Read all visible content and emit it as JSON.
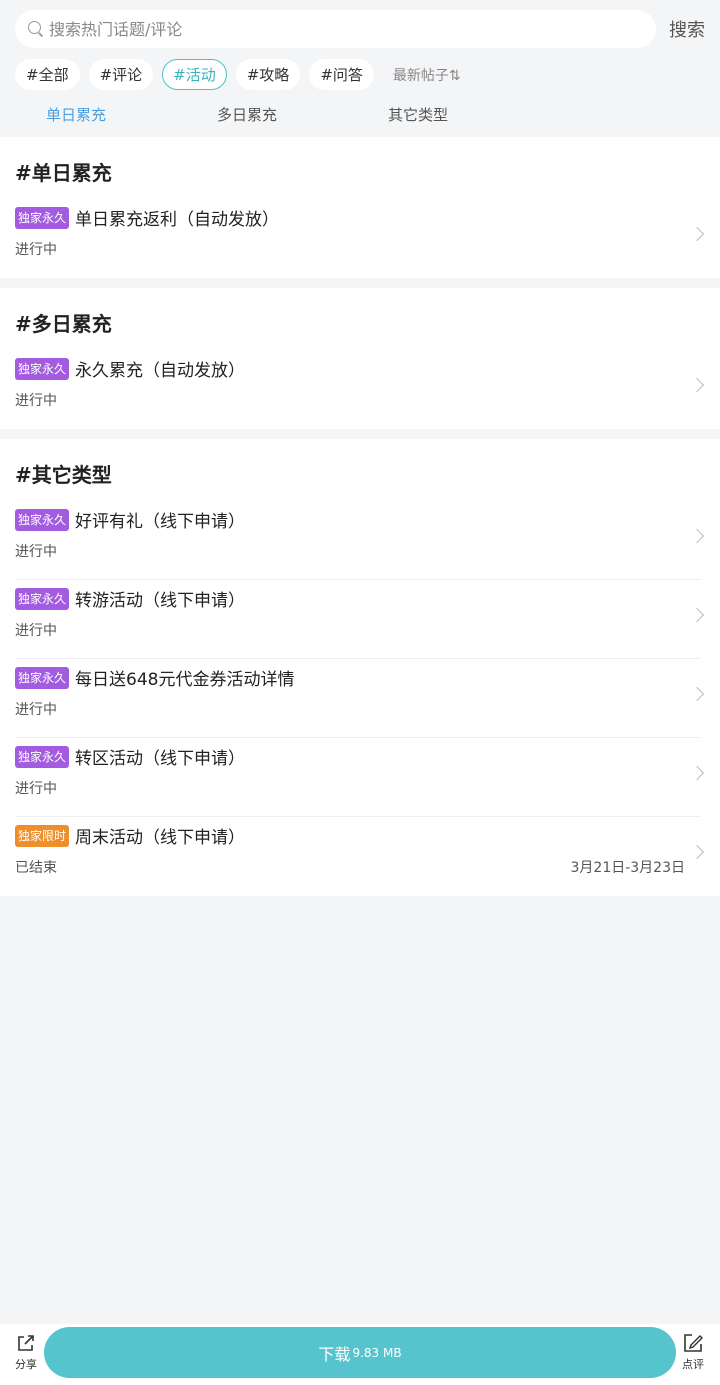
{
  "search": {
    "placeholder": "搜索热门话题/评论",
    "button_label": "搜索"
  },
  "chips": [
    {
      "label": "#全部",
      "active": false
    },
    {
      "label": "#评论",
      "active": false
    },
    {
      "label": "#活动",
      "active": true
    },
    {
      "label": "#攻略",
      "active": false
    },
    {
      "label": "#问答",
      "active": false
    }
  ],
  "sort_label": "最新帖子⇅",
  "subtabs": [
    {
      "label": "单日累充",
      "active": true
    },
    {
      "label": "多日累充",
      "active": false
    },
    {
      "label": "其它类型",
      "active": false
    }
  ],
  "sections": [
    {
      "title": "#单日累充",
      "items": [
        {
          "badge": "独家永久",
          "badge_color": "#a35ce0",
          "title": "单日累充返利（自动发放）",
          "status": "进行中",
          "date": ""
        }
      ]
    },
    {
      "title": "#多日累充",
      "items": [
        {
          "badge": "独家永久",
          "badge_color": "#a35ce0",
          "title": "永久累充（自动发放）",
          "status": "进行中",
          "date": ""
        }
      ]
    },
    {
      "title": "#其它类型",
      "items": [
        {
          "badge": "独家永久",
          "badge_color": "#a35ce0",
          "title": "好评有礼（线下申请）",
          "status": "进行中",
          "date": ""
        },
        {
          "badge": "独家永久",
          "badge_color": "#a35ce0",
          "title": "转游活动（线下申请）",
          "status": "进行中",
          "date": ""
        },
        {
          "badge": "独家永久",
          "badge_color": "#a35ce0",
          "title": "每日送648元代金券活动详情",
          "status": "进行中",
          "date": ""
        },
        {
          "badge": "独家永久",
          "badge_color": "#a35ce0",
          "title": "转区活动（线下申请）",
          "status": "进行中",
          "date": ""
        },
        {
          "badge": "独家限时",
          "badge_color": "#ef8f2c",
          "title": "周末活动（线下申请）",
          "status": "已结束",
          "date": "3月21日-3月23日"
        }
      ]
    }
  ],
  "bottom": {
    "share_label": "分享",
    "download_label": "下载",
    "download_size": "9.83 MB",
    "review_label": "点评"
  },
  "colors": {
    "accent": "#56c4cc",
    "tab_active": "#4a9fe0",
    "badge_purple": "#a35ce0",
    "badge_orange": "#ef8f2c"
  }
}
